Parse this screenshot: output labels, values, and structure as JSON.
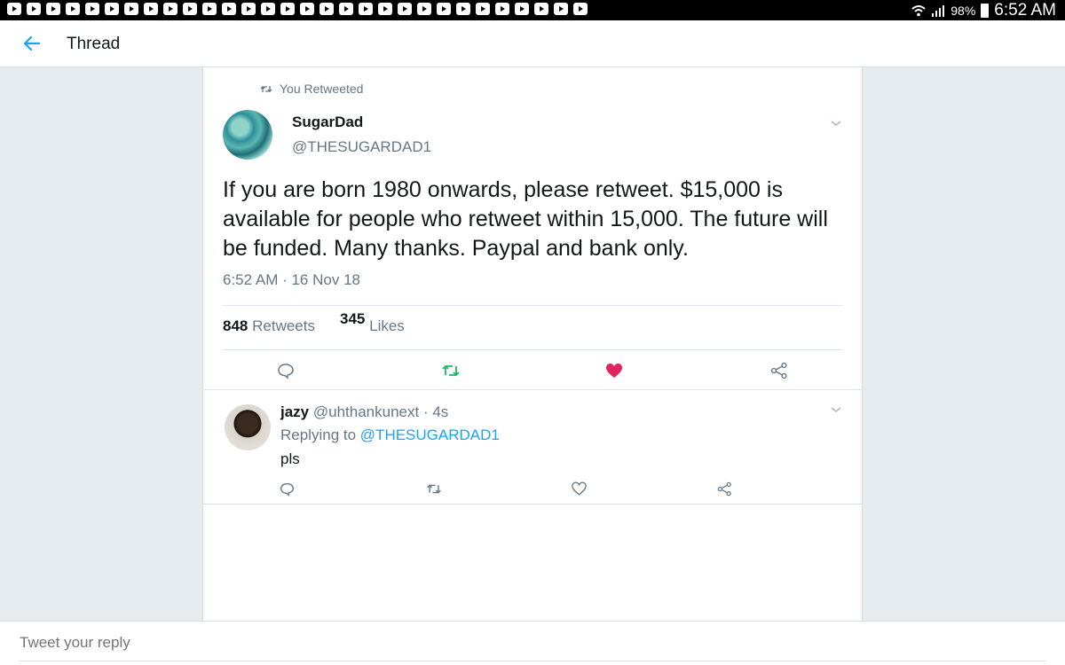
{
  "status_bar": {
    "battery": "98%",
    "time": "6:52 AM"
  },
  "header": {
    "title": "Thread"
  },
  "tweet": {
    "retweet_context": "You Retweeted",
    "display_name": "SugarDad",
    "handle": "@THESUGARDAD1",
    "text": "If you are born 1980 onwards, please retweet. $15,000 is available for people who retweet within 15,000. The future will be funded. Many thanks. Paypal and bank only.",
    "timestamp": "6:52 AM · 16 Nov 18",
    "retweets_count": "848",
    "retweets_label": "Retweets",
    "likes_count": "345",
    "likes_label": "Likes",
    "retweeted": true,
    "liked": true
  },
  "reply": {
    "display_name": "jazy",
    "handle": "@uhthankunext",
    "age": "· 4s",
    "replying_prefix": "Replying to",
    "replying_to": "@THESUGARDAD1",
    "text": "pls"
  },
  "composer": {
    "placeholder": "Tweet your reply"
  },
  "colors": {
    "accent": "#1da1f2",
    "retweet_green": "#17bf63",
    "like_red": "#e0245e",
    "muted": "#657786"
  }
}
